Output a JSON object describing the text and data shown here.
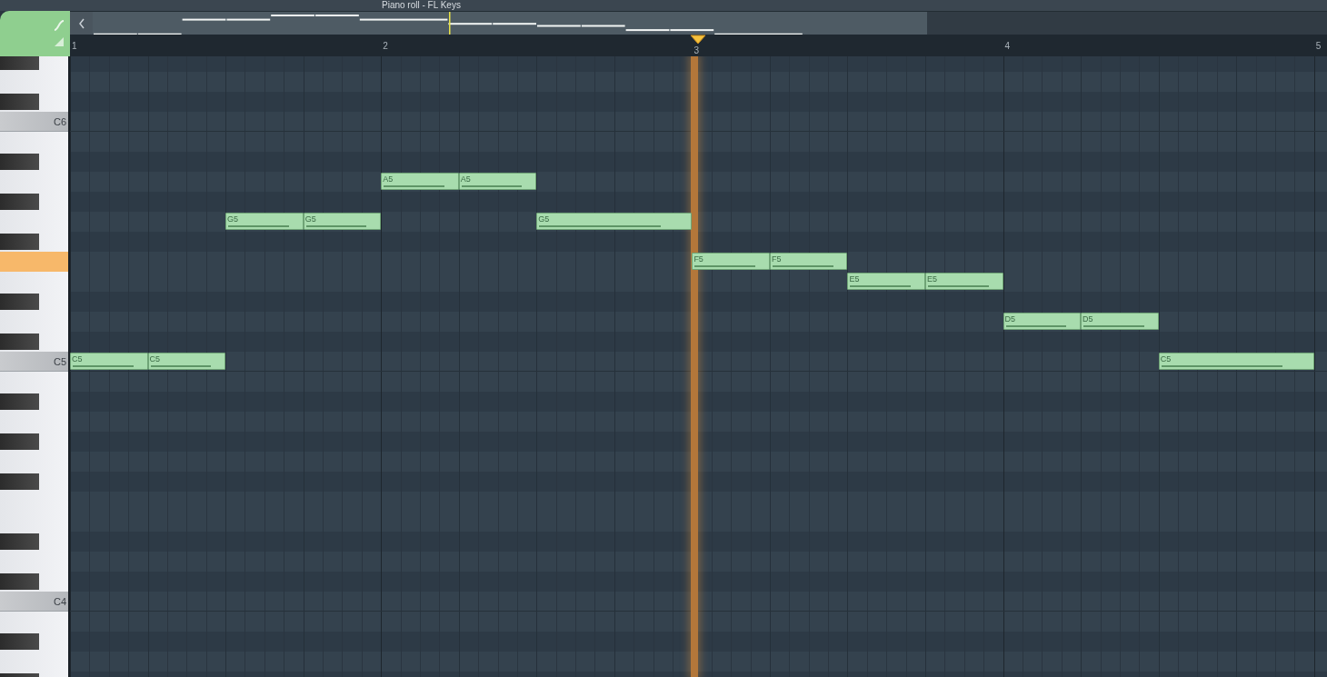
{
  "toolbar": {
    "title": "Piano roll - FL Keys"
  },
  "ruler": {
    "labels": [
      "1",
      "2",
      "3",
      "4",
      "5"
    ]
  },
  "playhead": {
    "level": 0.502
  },
  "keys": [
    {
      "kind": "black",
      "pressed": false
    },
    {
      "kind": "white",
      "pressed": false
    },
    {
      "kind": "black",
      "pressed": false
    },
    {
      "kind": "c",
      "label": "C6",
      "pressed": false
    },
    {
      "kind": "white",
      "pressed": false
    },
    {
      "kind": "black",
      "pressed": false
    },
    {
      "kind": "white",
      "pressed": false,
      "cells": [
        {
          "kind": "empty"
        },
        {
          "kind": "empty"
        },
        {
          "kind": "empty"
        },
        {
          "kind": "empty"
        },
        {
          "kind": "note",
          "label": "A5"
        },
        {
          "kind": "note",
          "label": "A5"
        },
        {
          "kind": "empty"
        },
        {
          "kind": "empty"
        },
        {
          "kind": "empty"
        },
        {
          "kind": "empty"
        },
        {
          "kind": "empty"
        },
        {
          "kind": "empty"
        },
        {
          "kind": "empty"
        },
        {
          "kind": "empty"
        },
        {
          "kind": "empty"
        },
        {
          "kind": "empty"
        }
      ]
    },
    {
      "kind": "black",
      "pressed": false
    },
    {
      "kind": "white",
      "pressed": false,
      "cells": [
        {
          "kind": "empty"
        },
        {
          "kind": "empty"
        },
        {
          "kind": "note",
          "label": "G5"
        },
        {
          "kind": "note",
          "label": "G5"
        },
        {
          "kind": "empty"
        },
        {
          "kind": "empty"
        },
        {
          "kind": "note",
          "label": "G5"
        },
        {
          "kind": "tie"
        },
        {
          "kind": "empty"
        },
        {
          "kind": "empty"
        },
        {
          "kind": "empty"
        },
        {
          "kind": "empty"
        },
        {
          "kind": "empty"
        },
        {
          "kind": "empty"
        },
        {
          "kind": "empty"
        },
        {
          "kind": "empty"
        }
      ]
    },
    {
      "kind": "black",
      "pressed": false
    },
    {
      "kind": "white",
      "pressed": true,
      "cells": [
        {
          "kind": "empty"
        },
        {
          "kind": "empty"
        },
        {
          "kind": "empty"
        },
        {
          "kind": "empty"
        },
        {
          "kind": "empty"
        },
        {
          "kind": "empty"
        },
        {
          "kind": "empty"
        },
        {
          "kind": "empty"
        },
        {
          "kind": "note",
          "label": "F5"
        },
        {
          "kind": "note",
          "label": "F5"
        },
        {
          "kind": "empty"
        },
        {
          "kind": "empty"
        },
        {
          "kind": "empty"
        },
        {
          "kind": "empty"
        },
        {
          "kind": "empty"
        },
        {
          "kind": "empty"
        }
      ]
    },
    {
      "kind": "white",
      "pressed": false,
      "cells": [
        {
          "kind": "empty"
        },
        {
          "kind": "empty"
        },
        {
          "kind": "empty"
        },
        {
          "kind": "empty"
        },
        {
          "kind": "empty"
        },
        {
          "kind": "empty"
        },
        {
          "kind": "empty"
        },
        {
          "kind": "empty"
        },
        {
          "kind": "empty"
        },
        {
          "kind": "empty"
        },
        {
          "kind": "note",
          "label": "E5"
        },
        {
          "kind": "note",
          "label": "E5"
        },
        {
          "kind": "empty"
        },
        {
          "kind": "empty"
        },
        {
          "kind": "empty"
        },
        {
          "kind": "empty"
        }
      ]
    },
    {
      "kind": "black",
      "pressed": false
    },
    {
      "kind": "white",
      "pressed": false,
      "cells": [
        {
          "kind": "empty"
        },
        {
          "kind": "empty"
        },
        {
          "kind": "empty"
        },
        {
          "kind": "empty"
        },
        {
          "kind": "empty"
        },
        {
          "kind": "empty"
        },
        {
          "kind": "empty"
        },
        {
          "kind": "empty"
        },
        {
          "kind": "empty"
        },
        {
          "kind": "empty"
        },
        {
          "kind": "empty"
        },
        {
          "kind": "empty"
        },
        {
          "kind": "note",
          "label": "D5"
        },
        {
          "kind": "note",
          "label": "D5"
        },
        {
          "kind": "empty"
        },
        {
          "kind": "empty"
        }
      ]
    },
    {
      "kind": "black",
      "pressed": false
    },
    {
      "kind": "c",
      "label": "C5",
      "pressed": false,
      "cells": [
        {
          "kind": "note",
          "label": "C5"
        },
        {
          "kind": "note",
          "label": "C5"
        },
        {
          "kind": "empty"
        },
        {
          "kind": "empty"
        },
        {
          "kind": "empty"
        },
        {
          "kind": "empty"
        },
        {
          "kind": "empty"
        },
        {
          "kind": "empty"
        },
        {
          "kind": "empty"
        },
        {
          "kind": "empty"
        },
        {
          "kind": "empty"
        },
        {
          "kind": "empty"
        },
        {
          "kind": "empty"
        },
        {
          "kind": "empty"
        },
        {
          "kind": "note",
          "label": "C5"
        },
        {
          "kind": "tie"
        }
      ]
    },
    {
      "kind": "white",
      "pressed": false
    },
    {
      "kind": "black",
      "pressed": false
    },
    {
      "kind": "white",
      "pressed": false
    },
    {
      "kind": "black",
      "pressed": false
    },
    {
      "kind": "white",
      "pressed": false
    },
    {
      "kind": "black",
      "pressed": false
    },
    {
      "kind": "white",
      "pressed": false
    },
    {
      "kind": "white",
      "pressed": false
    },
    {
      "kind": "black",
      "pressed": false
    },
    {
      "kind": "white",
      "pressed": false
    },
    {
      "kind": "black",
      "pressed": false
    },
    {
      "kind": "c",
      "label": "C4",
      "pressed": false
    },
    {
      "kind": "white",
      "pressed": false
    },
    {
      "kind": "black",
      "pressed": false
    },
    {
      "kind": "white",
      "pressed": false
    },
    {
      "kind": "black",
      "pressed": false
    }
  ]
}
